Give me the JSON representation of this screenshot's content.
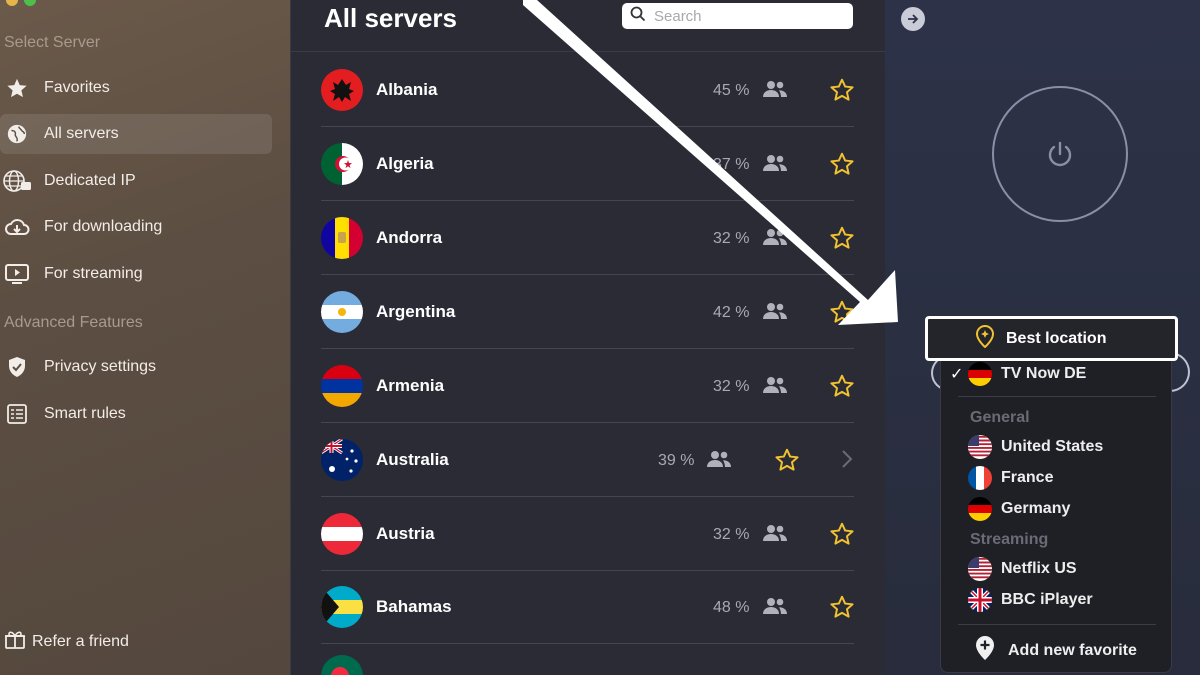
{
  "sidebar": {
    "section_select": "Select Server",
    "section_advanced": "Advanced Features",
    "items": [
      {
        "label": "Favorites",
        "icon": "star-icon"
      },
      {
        "label": "All servers",
        "icon": "globe-icon",
        "active": true
      },
      {
        "label": "Dedicated IP",
        "icon": "dedicated-ip-icon"
      },
      {
        "label": "For downloading",
        "icon": "cloud-download-icon"
      },
      {
        "label": "For streaming",
        "icon": "play-screen-icon"
      }
    ],
    "advanced_items": [
      {
        "label": "Privacy settings",
        "icon": "shield-check-icon"
      },
      {
        "label": "Smart rules",
        "icon": "rules-list-icon"
      }
    ],
    "refer_label": "Refer a friend"
  },
  "server_list": {
    "title": "All servers",
    "search_placeholder": "Search",
    "rows": [
      {
        "country": "Albania",
        "load": "45 %"
      },
      {
        "country": "Algeria",
        "load": "37 %"
      },
      {
        "country": "Andorra",
        "load": "32 %"
      },
      {
        "country": "Argentina",
        "load": "42 %"
      },
      {
        "country": "Armenia",
        "load": "32 %"
      },
      {
        "country": "Australia",
        "load": "39 %"
      },
      {
        "country": "Austria",
        "load": "32 %"
      },
      {
        "country": "Bahamas",
        "load": "48 %"
      }
    ]
  },
  "dropdown": {
    "best_location": "Best location",
    "current": "TV Now DE",
    "section_general": "General",
    "general_items": [
      "United States",
      "France",
      "Germany"
    ],
    "section_streaming": "Streaming",
    "streaming_items": [
      "Netflix US",
      "BBC iPlayer"
    ],
    "add_favorite": "Add new favorite"
  },
  "colors": {
    "sidebar_bg": "#5c4e42",
    "list_bg": "#2a2b35",
    "accent_star": "#f2c230",
    "highlight_border": "#ffffff"
  }
}
